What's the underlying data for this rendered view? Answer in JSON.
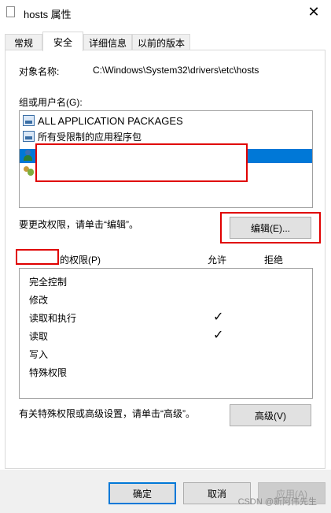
{
  "window": {
    "title": "hosts 属性",
    "close_glyph": "✕"
  },
  "tabs": [
    {
      "label": "常规"
    },
    {
      "label": "安全"
    },
    {
      "label": "详细信息"
    },
    {
      "label": "以前的版本"
    }
  ],
  "security": {
    "object_label": "对象名称:",
    "object_value": "C:\\Windows\\System32\\drivers\\etc\\hosts",
    "group_label": "组或用户名(G):",
    "groups": [
      {
        "label": "ALL APPLICATION PACKAGES",
        "icon": "group-icon"
      },
      {
        "label": "所有受限制的应用程序包",
        "icon": "group-icon"
      },
      {
        "label": "",
        "icon": "user-icon"
      },
      {
        "label": "",
        "icon": "users-icon"
      }
    ],
    "change_hint": "要更改权限，请单击“编辑”。",
    "edit_button": "编辑(E)...",
    "perm_header_suffix": "的权限(P)",
    "allow_label": "允许",
    "deny_label": "拒绝",
    "permissions": [
      {
        "name": "完全控制",
        "allow": false
      },
      {
        "name": "修改",
        "allow": false
      },
      {
        "name": "读取和执行",
        "allow": true
      },
      {
        "name": "读取",
        "allow": true
      },
      {
        "name": "写入",
        "allow": false
      },
      {
        "name": "特殊权限",
        "allow": false
      }
    ],
    "check_glyph": "✓",
    "advanced_hint": "有关特殊权限或高级设置，请单击“高级”。",
    "advanced_button": "高级(V)"
  },
  "footer": {
    "ok": "确定",
    "cancel": "取消",
    "apply": "应用(A)"
  },
  "watermark": "CSDN @新阿伟先生",
  "colors": {
    "selection": "#0078d7",
    "annotation_red": "#e00000"
  }
}
